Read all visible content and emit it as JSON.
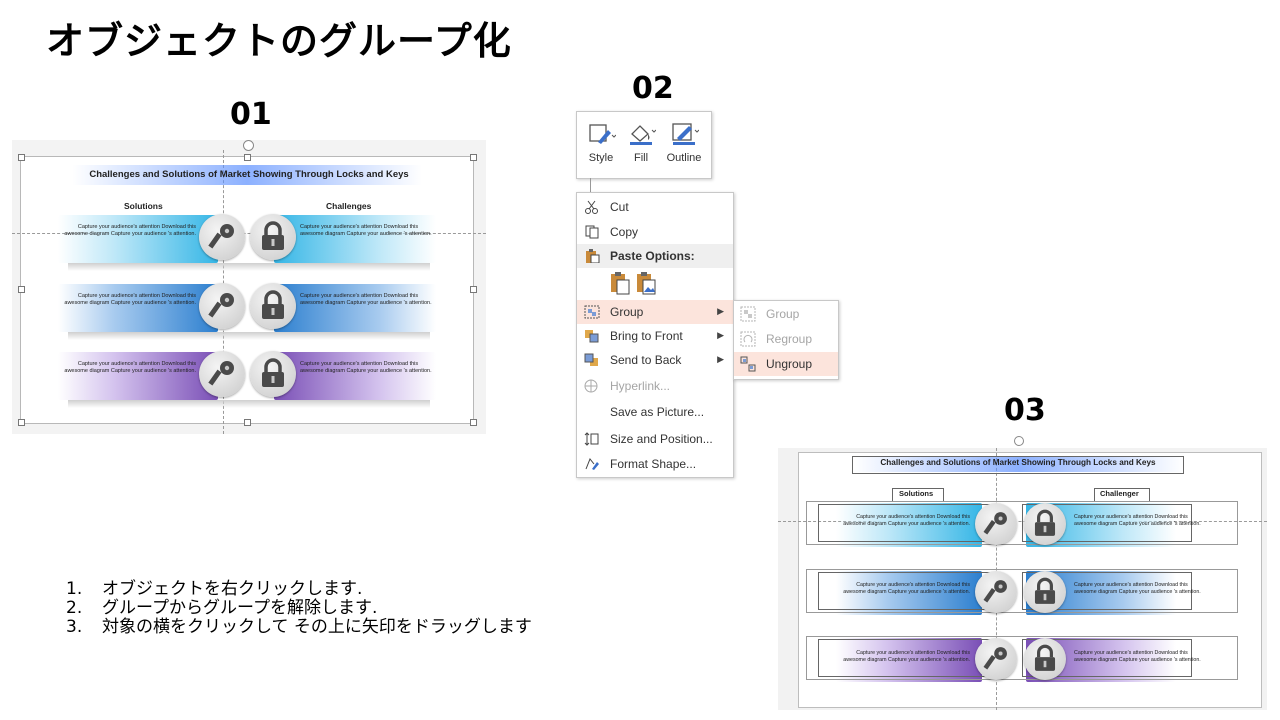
{
  "title": "オブジェクトのグループ化",
  "labels": {
    "step1": "01",
    "step2": "02",
    "step3": "03"
  },
  "slide": {
    "title": "Challenges and Solutions of Market Showing Through Locks and Keys",
    "col_left": "Solutions",
    "col_right": "Challenges",
    "col_right_panel3": "Challenger",
    "body_text": "Capture your audience's attention Download this awesome diagram Capture your  audience 's attention.",
    "colors": {
      "band1": "#35b6e6",
      "band2": "#2c7fcf",
      "band3": "#7a4fb6",
      "accent": "#2a6de0"
    }
  },
  "ribbon": {
    "buttons": [
      {
        "label": "Style",
        "icon": "style-icon"
      },
      {
        "label": "Fill",
        "icon": "fill-bucket-icon"
      },
      {
        "label": "Outline",
        "icon": "outline-pen-icon"
      }
    ]
  },
  "context_menu": {
    "items": [
      {
        "label": "Cut",
        "icon": "scissors-icon"
      },
      {
        "label": "Copy",
        "icon": "copy-icon"
      },
      {
        "label": "Paste Options:",
        "icon": "clipboard-icon"
      },
      {
        "label": "Group",
        "icon": "group-icon",
        "highlighted": true,
        "submenu": true
      },
      {
        "label": "Bring to Front",
        "icon": "bring-front-icon",
        "submenu": true
      },
      {
        "label": "Send to Back",
        "icon": "send-back-icon",
        "submenu": true
      },
      {
        "label": "Hyperlink...",
        "icon": "hyperlink-icon",
        "disabled": true
      },
      {
        "label": "Save as Picture...",
        "icon": ""
      },
      {
        "label": "Size and Position...",
        "icon": "size-position-icon"
      },
      {
        "label": "Format Shape...",
        "icon": "format-shape-icon"
      }
    ],
    "submenu": [
      {
        "label": "Group",
        "icon": "group-icon",
        "disabled": true
      },
      {
        "label": "Regroup",
        "icon": "regroup-icon",
        "disabled": true
      },
      {
        "label": "Ungroup",
        "icon": "ungroup-icon",
        "highlighted": true
      }
    ]
  },
  "steps": [
    {
      "n": "1.",
      "text": "オブジェクトを右クリックします."
    },
    {
      "n": "2.",
      "text": "グループからグループを解除します."
    },
    {
      "n": "3.",
      "text": "対象の横をクリックして その上に矢印をドラッグします"
    }
  ]
}
